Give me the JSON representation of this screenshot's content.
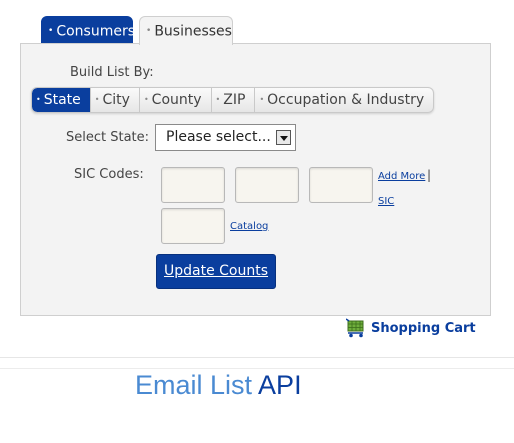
{
  "tabs": {
    "consumers": "Consumers",
    "businesses": "Businesses",
    "bullet": "•"
  },
  "build_list": {
    "label": "Build List By:",
    "subtabs": [
      "State",
      "City",
      "County",
      "ZIP",
      "Occupation & Industry"
    ],
    "active": "State"
  },
  "state": {
    "label": "Select State:",
    "selected": "Please select..."
  },
  "sic": {
    "label": "SIC Codes:",
    "add_more": "Add More",
    "separator": "|",
    "sic_link": "SIC",
    "catalog": "Catalog"
  },
  "update_button": "Update Counts",
  "cart": {
    "label": "Shopping Cart",
    "icon": "shopping-cart-icon"
  },
  "footer": {
    "part1": "Email List",
    "part2": "API"
  },
  "colors": {
    "primary": "#0a3e9e",
    "accent_light": "#4a8ad2",
    "panel_bg": "#f3f3f3"
  }
}
